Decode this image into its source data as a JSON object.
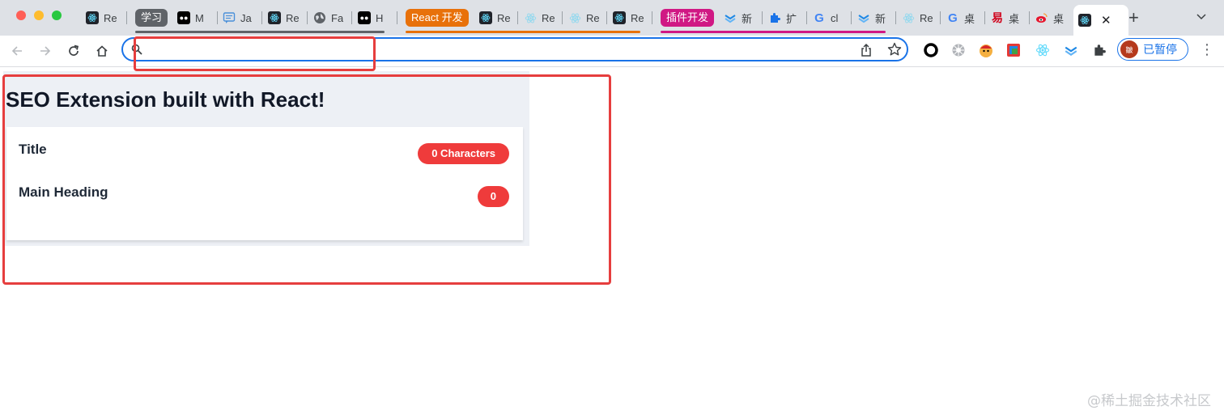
{
  "browser": {
    "tabs": [
      {
        "label": "Re",
        "icon": "react-icon"
      },
      {
        "label": "M",
        "icon": "medium-icon"
      },
      {
        "label": "Ja",
        "icon": "chat-icon"
      },
      {
        "label": "Re",
        "icon": "react-icon"
      },
      {
        "label": "Fa",
        "icon": "globe-icon"
      },
      {
        "label": "H",
        "icon": "medium-icon"
      },
      {
        "label": "Re",
        "icon": "react-icon"
      },
      {
        "label": "Re",
        "icon": "react-light-icon"
      },
      {
        "label": "Re",
        "icon": "react-light-icon"
      },
      {
        "label": "Re",
        "icon": "react-icon"
      },
      {
        "label": "新",
        "icon": "yuque-icon"
      },
      {
        "label": "扩",
        "icon": "puzzle-icon"
      },
      {
        "label": "cl",
        "icon": "google-icon"
      },
      {
        "label": "新",
        "icon": "yuque-icon"
      },
      {
        "label": "Re",
        "icon": "react-light-icon"
      },
      {
        "label": "桌",
        "icon": "google-icon"
      },
      {
        "label": "桌",
        "icon": "netease-icon"
      },
      {
        "label": "桌",
        "icon": "weibo-icon"
      }
    ],
    "active_tab": {
      "label": "",
      "icon": "react-icon"
    },
    "tab_groups": [
      {
        "label": "学习",
        "color": "#5f6368"
      },
      {
        "label": "React 开发",
        "color": "#e8710a"
      },
      {
        "label": "插件开发",
        "color": "#d01884"
      }
    ],
    "address_bar": {
      "value": "",
      "placeholder": ""
    },
    "profile": {
      "label": "已暂停",
      "avatar_text": "皺"
    }
  },
  "popup": {
    "title": "SEO Extension built with React!",
    "rows": [
      {
        "label": "Title",
        "badge": "0 Characters"
      },
      {
        "label": "Main Heading",
        "badge": "0"
      }
    ]
  },
  "colors": {
    "annotation": "#e63e3e",
    "badge": "#ef3b3b",
    "omnibox_focus": "#1a73e8"
  },
  "watermark": "@稀土掘金技术社区"
}
